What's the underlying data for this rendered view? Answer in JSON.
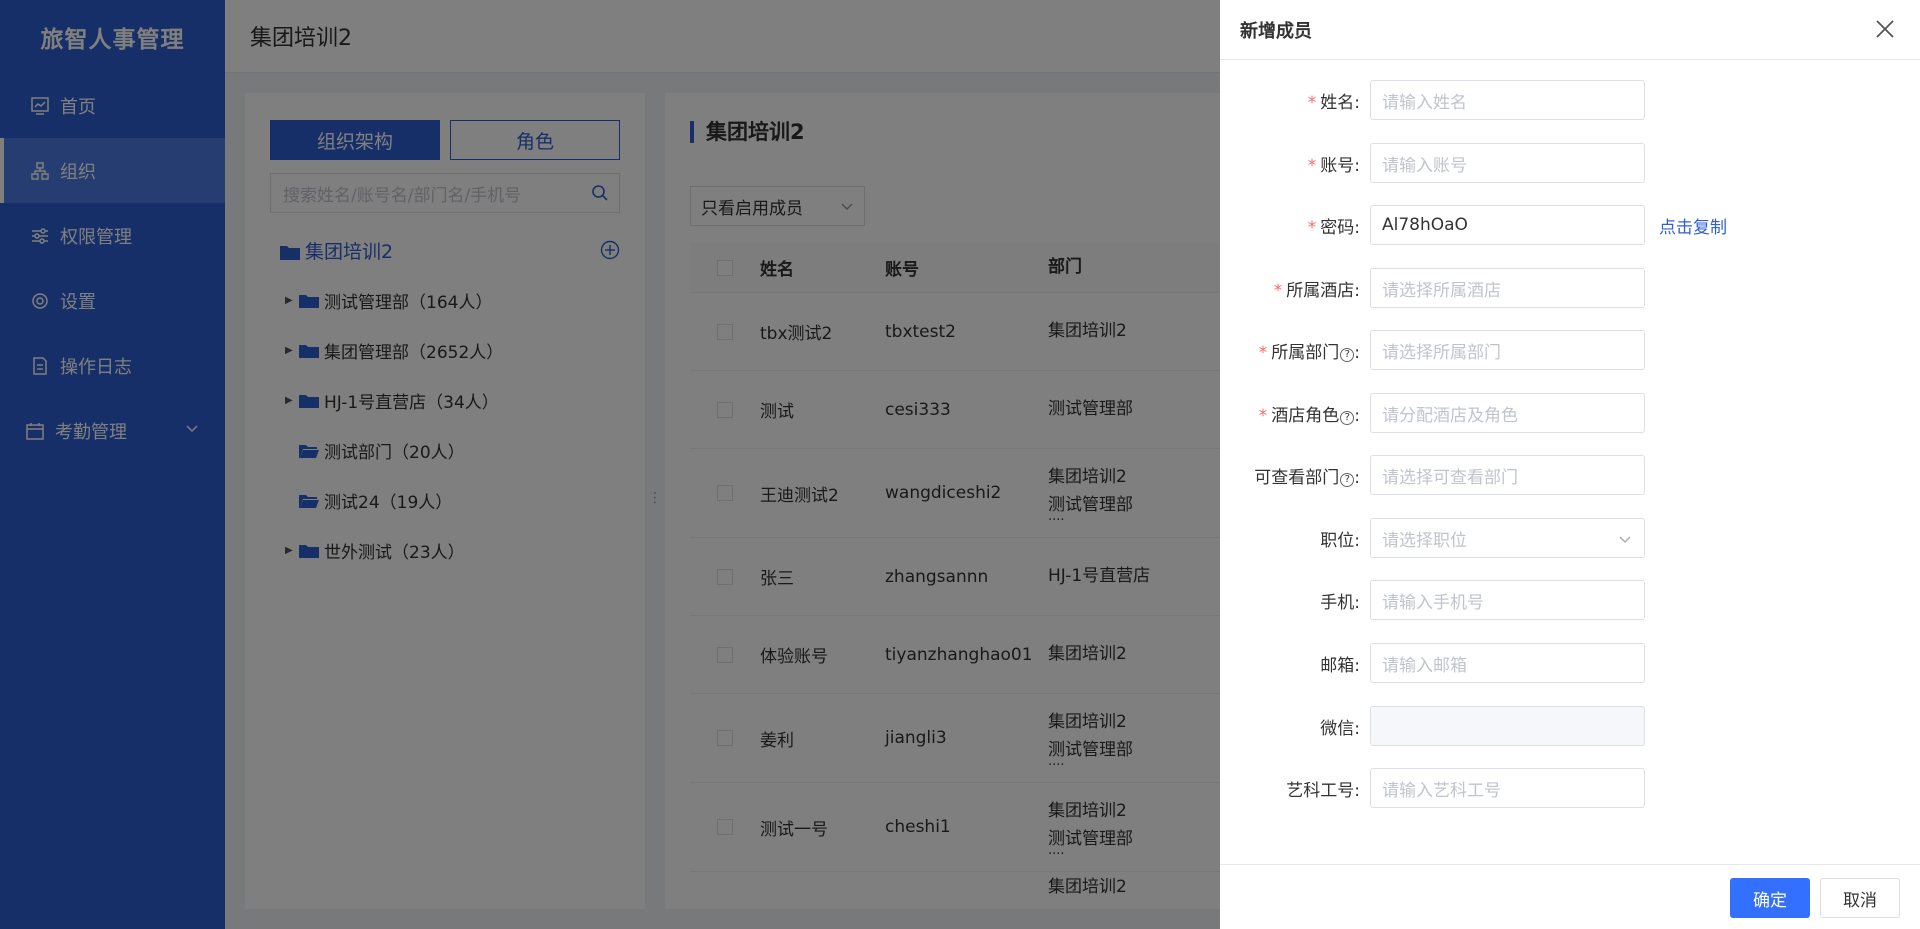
{
  "app": {
    "brand": "旅智人事管理"
  },
  "sidebar": {
    "items": [
      {
        "label": "首页",
        "icon": "chart-icon"
      },
      {
        "label": "组织",
        "icon": "org-icon",
        "active": true
      },
      {
        "label": "权限管理",
        "icon": "sliders-icon"
      },
      {
        "label": "设置",
        "icon": "gear-icon"
      },
      {
        "label": "操作日志",
        "icon": "document-icon"
      },
      {
        "label": "考勤管理",
        "icon": "calendar-icon"
      }
    ]
  },
  "header": {
    "title": "集团培训2"
  },
  "tree_panel": {
    "tab_org": "组织架构",
    "tab_role": "角色",
    "search_placeholder": "搜索姓名/账号名/部门名/手机号",
    "root": "集团培训2",
    "nodes": [
      "测试管理部（164人）",
      "集团管理部（2652人）",
      "HJ-1号直营店（34人）",
      "测试部门（20人）",
      "测试24（19人）",
      "世外测试（23人）"
    ]
  },
  "main_panel": {
    "title": "集团培训2",
    "filter": "只看启用成员",
    "columns": {
      "name": "姓名",
      "account": "账号",
      "dept": "部门"
    },
    "rows": [
      {
        "name": "tbx测试2",
        "account": "tbxtest2",
        "dept1": "集团培训2",
        "dept2": "",
        "more": ""
      },
      {
        "name": "测试",
        "account": "cesi333",
        "dept1": "测试管理部",
        "dept2": "",
        "more": ""
      },
      {
        "name": "王迪测试2",
        "account": "wangdiceshi2",
        "dept1": "集团培训2",
        "dept2": "测试管理部",
        "more": "····"
      },
      {
        "name": "张三",
        "account": "zhangsannn",
        "dept1": "HJ-1号直营店",
        "dept2": "",
        "more": ""
      },
      {
        "name": "体验账号",
        "account": "tiyanzhanghao01",
        "dept1": "集团培训2",
        "dept2": "",
        "more": ""
      },
      {
        "name": "姜利",
        "account": "jiangli3",
        "dept1": "集团培训2",
        "dept2": "测试管理部",
        "more": "····"
      },
      {
        "name": "测试一号",
        "account": "cheshi1",
        "dept1": "集团培训2",
        "dept2": "测试管理部",
        "more": "····"
      },
      {
        "name": "",
        "account": "",
        "dept1": "集团培训2",
        "dept2": "",
        "more": ""
      }
    ]
  },
  "drawer": {
    "title": "新增成员",
    "fields": {
      "name": {
        "label": "姓名:",
        "placeholder": "请输入姓名"
      },
      "account": {
        "label": "账号:",
        "placeholder": "请输入账号"
      },
      "password": {
        "label": "密码:",
        "value": "Al78hOaO",
        "copy": "点击复制"
      },
      "hotel": {
        "label": "所属酒店:",
        "placeholder": "请选择所属酒店"
      },
      "dept": {
        "label": "所属部门",
        "placeholder": "请选择所属部门"
      },
      "role": {
        "label": "酒店角色",
        "placeholder": "请分配酒店及角色"
      },
      "viewdept": {
        "label": "可查看部门",
        "placeholder": "请选择可查看部门"
      },
      "position": {
        "label": "职位:",
        "placeholder": "请选择职位"
      },
      "phone": {
        "label": "手机:",
        "placeholder": "请输入手机号"
      },
      "email": {
        "label": "邮箱:",
        "placeholder": "请输入邮箱"
      },
      "wechat": {
        "label": "微信:",
        "placeholder": ""
      },
      "yike": {
        "label": "艺科工号:",
        "placeholder": "请输入艺科工号"
      }
    },
    "confirm": "确定",
    "cancel": "取消"
  },
  "colors": {
    "primary": "#2f5fd0",
    "button": "#3370ff",
    "required": "#f56c6c"
  }
}
